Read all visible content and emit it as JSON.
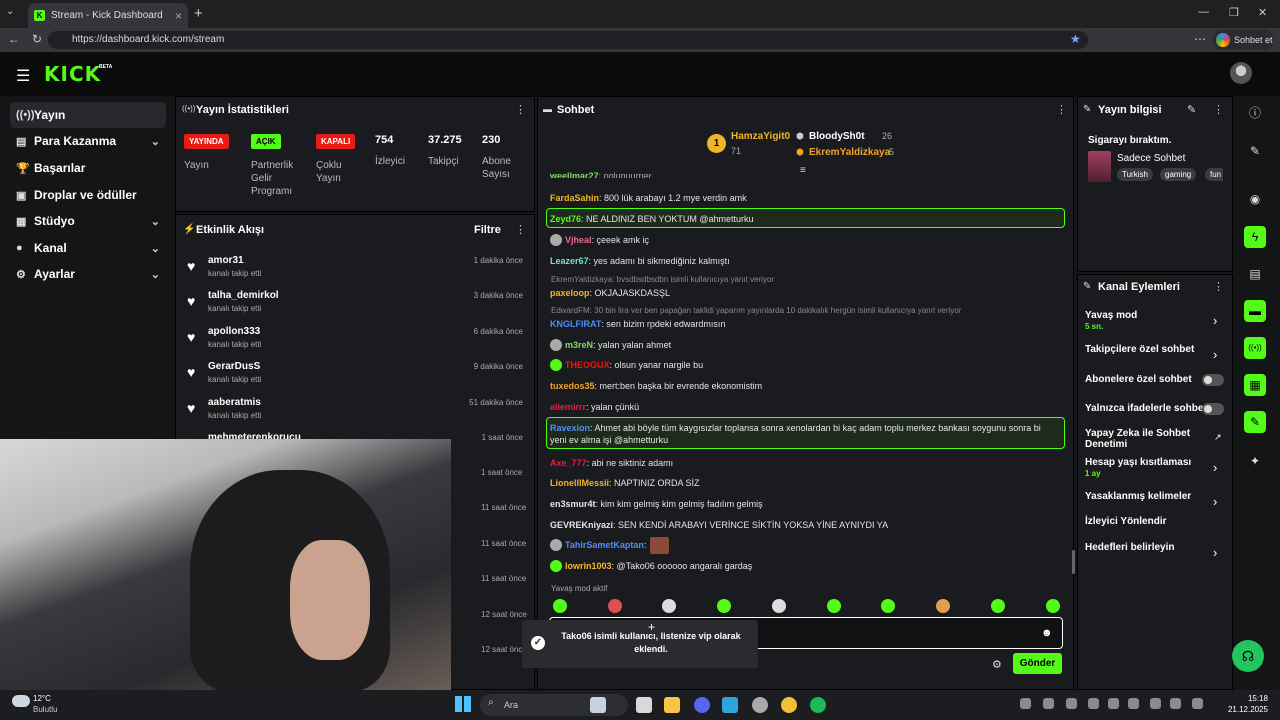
{
  "browser": {
    "tab_title": "Stream - Kick Dashboard",
    "url": "https://dashboard.kick.com/stream",
    "sohbet_label": "Sohbet et"
  },
  "header": {
    "logo": "KICK",
    "beta": "BETA"
  },
  "sidebar": {
    "items": [
      {
        "label": "Yayın",
        "icon": "broadcast-icon"
      },
      {
        "label": "Para Kazanma",
        "icon": "money-icon"
      },
      {
        "label": "Başarılar",
        "icon": "trophy-icon"
      },
      {
        "label": "Droplar ve ödüller",
        "icon": "gift-icon"
      },
      {
        "label": "Stüdyo",
        "icon": "studio-icon"
      },
      {
        "label": "Kanal",
        "icon": "user-icon"
      },
      {
        "label": "Ayarlar",
        "icon": "gear-icon"
      }
    ]
  },
  "stats": {
    "title": "Yayın İstatistikleri",
    "badges": [
      {
        "badge": "YAYINDA",
        "label": "Yayın",
        "color": "#e91916"
      },
      {
        "badge": "AÇIK",
        "label": "Partnerlik Gelir Programı",
        "color": "#53fc18"
      },
      {
        "badge": "KAPALI",
        "label": "Çoklu Yayın",
        "color": "#e91916"
      }
    ],
    "numbers": [
      {
        "value": "754",
        "label": "İzleyici"
      },
      {
        "value": "37.275",
        "label": "Takipçi"
      },
      {
        "value": "230",
        "label": "Abone Sayısı"
      }
    ]
  },
  "activity": {
    "title": "Etkinlik Akışı",
    "filter": "Filtre",
    "items": [
      {
        "user": "amor31",
        "desc": "kanalı takip etti",
        "time": "1 dakika önce"
      },
      {
        "user": "talha_demirkol",
        "desc": "kanalı takip etti",
        "time": "3 dakika önce"
      },
      {
        "user": "apollon333",
        "desc": "kanalı takip etti",
        "time": "6 dakika önce"
      },
      {
        "user": "GerarDusS",
        "desc": "kanalı takip etti",
        "time": "9 dakika önce"
      },
      {
        "user": "aaberatmis",
        "desc": "kanalı takip etti",
        "time": "51 dakika önce"
      },
      {
        "user": "mehmeterenkorucu",
        "desc": "",
        "time": "1 saat önce"
      }
    ],
    "extra_times": [
      "1 saat önce",
      "11 saat önce",
      "11 saat önce",
      "11 saat önce",
      "12 saat önce",
      "12 saat önce"
    ]
  },
  "chat": {
    "title": "Sohbet",
    "top": [
      {
        "rank": "1",
        "name": "HamzaYigit0",
        "score": "71"
      },
      {
        "name": "BloodySh0t",
        "score": "26"
      },
      {
        "name": "EkremYaldizkaya",
        "score": "5"
      }
    ],
    "messages": [
      {
        "user": "FardaSahin",
        "color": "#f0b429",
        "text": "800 lük arabayı 1.2 mye verdin amk"
      },
      {
        "user": "Zeyd76",
        "color": "#53fc18",
        "text": "NE ALDINIZ BEN YOKTUM @ahmetturku"
      },
      {
        "user": "Vjheal",
        "color": "#e86a8f",
        "text": "çeeek amk iç"
      },
      {
        "user": "Leazer67",
        "color": "#7fdbda",
        "text": "yes adamı bi sikmediğiniz kalmıştı"
      },
      {
        "user": "paxeloop",
        "color": "#f0b429",
        "text": "OKJAJASKDASŞL"
      },
      {
        "user": "KNGLFIRAT",
        "color": "#4f8ef7",
        "text": "sen bizim rpdeki edwardmısın"
      },
      {
        "user": "m3reN",
        "color": "#7fdb6a",
        "text": "yalan yalan ahmet"
      },
      {
        "user": "THEOGUX",
        "color": "#e91916",
        "text": "olsun yanar nargile bu"
      },
      {
        "user": "tuxedos35",
        "color": "#f0a429",
        "text": "mert:ben başka bir evrende ekonomistim"
      },
      {
        "user": "aliemirrr",
        "color": "#e91946",
        "text": "yalan çünkü"
      },
      {
        "user": "Ravexion",
        "color": "#4f8ef7",
        "text": "Ahmet abi böyle tüm kaygısızlar toplansa sonra xenolardan bi kaç adam toplu merkez bankası soygunu sonra bi yeni ev alma işi @ahmetturku"
      },
      {
        "user": "Axe_777",
        "color": "#e91946",
        "text": "abi ne siktiniz adamı"
      },
      {
        "user": "LionelllMessii",
        "color": "#f0b429",
        "text": "NAPTINIZ ORDA SİZ"
      },
      {
        "user": "en3smur4t",
        "color": "#e5e5e5",
        "text": "kim kim gelmiş kim gelmiş fadılım gelmiş"
      },
      {
        "user": "GEVREKniyazi",
        "color": "#e5e5e5",
        "text": "SEN KENDİ ARABAYI VERİNCE SİKTİN YOKSA YİNE AYNIYDI YA"
      },
      {
        "user": "TahirSametKaptan",
        "color": "#4f8ef7",
        "text": ""
      },
      {
        "user": "lowrin1003",
        "color": "#f0b429",
        "text": "@Tako06 oooooo angaralı gardaş"
      }
    ],
    "cut_user": "weellmar27",
    "cut_text": "oolunuurner",
    "replies": [
      "EkremYaldizkaya: bvsdbsdbsdbn isimli kullanıcıya yanıt veriyor",
      "EdwardFM: 30 bin lira ver ben papağan taklidi yaparım yayınlarda 10 dakikalık hergün isimli kullanıcıya yanıt veriyor"
    ],
    "slow_mode": "Yavaş mod aktif",
    "send": "Gönder"
  },
  "stream_info": {
    "title": "Yayın bilgisi",
    "stream_title": "Sigarayı bıraktım.",
    "category": "Sadece Sohbet",
    "tags": [
      "Turkish",
      "gaming",
      "fun"
    ]
  },
  "channel_actions": {
    "title": "Kanal Eylemleri",
    "items": [
      {
        "label": "Yavaş mod",
        "sub": "5 sn.",
        "type": "arrow"
      },
      {
        "label": "Takipçilere özel sohbet",
        "sub": "",
        "type": "arrow"
      },
      {
        "label": "Abonelere özel sohbet",
        "sub": "",
        "type": "toggle"
      },
      {
        "label": "Yalnızca ifadelerle sohbet",
        "sub": "",
        "type": "toggle"
      },
      {
        "label": "Yapay Zeka ile Sohbet Denetimi",
        "sub": "",
        "type": "link"
      },
      {
        "label": "Hesap yaşı kısıtlaması",
        "sub": "1 ay",
        "type": "arrow"
      },
      {
        "label": "Yasaklanmış kelimeler",
        "sub": "",
        "type": "arrow"
      },
      {
        "label": "İzleyici Yönlendir",
        "sub": "",
        "type": "none"
      },
      {
        "label": "Hedefleri belirleyin",
        "sub": "",
        "type": "arrow"
      }
    ]
  },
  "toast": {
    "text": "Tako06 isimli kullanıcı, listenize vip olarak eklendi."
  },
  "taskbar": {
    "temp": "12°C",
    "weather": "Bulutlu",
    "search": "Ara",
    "time": "15:18",
    "date": "21.12.2025"
  }
}
